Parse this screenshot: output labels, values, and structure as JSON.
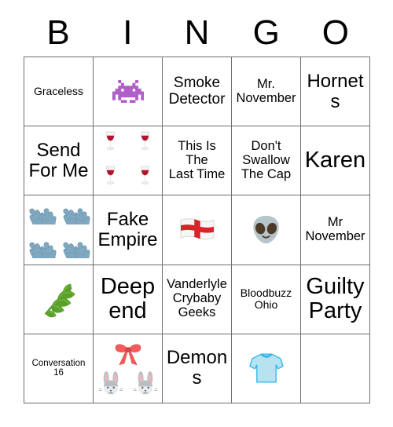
{
  "card": {
    "header_letters": [
      "B",
      "I",
      "N",
      "G",
      "O"
    ],
    "grid_size": "5x5",
    "background_color": "#ffffff",
    "border_color": "#6e6e6e",
    "text_color": "#000000"
  },
  "cells": [
    {
      "row": 1,
      "col": 1,
      "type": "text",
      "text": "Graceless",
      "size": "sm"
    },
    {
      "row": 1,
      "col": 2,
      "type": "emoji",
      "icon": "alien-monster-icon",
      "label": "space-invader",
      "count": 1
    },
    {
      "row": 1,
      "col": 3,
      "type": "text",
      "text": "Smoke\nDetector",
      "size": "lg"
    },
    {
      "row": 1,
      "col": 4,
      "type": "text",
      "text": "Mr.\nNovember",
      "size": "md"
    },
    {
      "row": 1,
      "col": 5,
      "type": "text",
      "text": "Hornets",
      "size": "xl"
    },
    {
      "row": 2,
      "col": 1,
      "type": "text",
      "text": "Send\nFor Me",
      "size": "xl"
    },
    {
      "row": 2,
      "col": 2,
      "type": "emoji",
      "icon": "wine-glass-icon",
      "label": "wine-glass",
      "count": 4
    },
    {
      "row": 2,
      "col": 3,
      "type": "text",
      "text": "This Is\nThe\nLast Time",
      "size": "md"
    },
    {
      "row": 2,
      "col": 4,
      "type": "text",
      "text": "Don't\nSwallow\nThe Cap",
      "size": "md"
    },
    {
      "row": 2,
      "col": 5,
      "type": "text",
      "text": "Karen",
      "size": "xxl"
    },
    {
      "row": 3,
      "col": 1,
      "type": "emoji",
      "icon": "gloves-icon",
      "label": "gloves",
      "count": 4
    },
    {
      "row": 3,
      "col": 2,
      "type": "text",
      "text": "Fake\nEmpire",
      "size": "xl"
    },
    {
      "row": 3,
      "col": 3,
      "type": "emoji",
      "icon": "flag-england-icon",
      "label": "england-flag",
      "count": 1
    },
    {
      "row": 3,
      "col": 4,
      "type": "emoji",
      "icon": "alien-face-icon",
      "label": "alien",
      "count": 1
    },
    {
      "row": 3,
      "col": 5,
      "type": "text",
      "text": "Mr\nNovember",
      "size": "md"
    },
    {
      "row": 4,
      "col": 1,
      "type": "emoji",
      "icon": "herb-icon",
      "label": "herb",
      "count": 1
    },
    {
      "row": 4,
      "col": 2,
      "type": "text",
      "text": "Deep\nend",
      "size": "xxl"
    },
    {
      "row": 4,
      "col": 3,
      "type": "text",
      "text": "Vanderlyle\nCrybaby\nGeeks",
      "size": "md"
    },
    {
      "row": 4,
      "col": 4,
      "type": "text",
      "text": "Bloodbuzz\nOhio",
      "size": "sm"
    },
    {
      "row": 4,
      "col": 5,
      "type": "text",
      "text": "Guilty\nParty",
      "size": "xxl"
    },
    {
      "row": 5,
      "col": 1,
      "type": "text",
      "text": "Conversation\n16",
      "size": "xs"
    },
    {
      "row": 5,
      "col": 2,
      "type": "emoji",
      "icon": "ribbon-rabbit-icon",
      "label": "ribbon-and-rabbits",
      "count": 3
    },
    {
      "row": 5,
      "col": 3,
      "type": "text",
      "text": "Demons",
      "size": "xl"
    },
    {
      "row": 5,
      "col": 4,
      "type": "emoji",
      "icon": "tshirt-icon",
      "label": "t-shirt",
      "count": 1
    }
  ],
  "colors": {
    "space_invader": "#b05fc8",
    "wine_red": "#b5132b",
    "glove_blue": "#7fa8c0",
    "flag_red": "#d8232a",
    "alien_gray": "#b6c4cc",
    "herb_green": "#66a838",
    "ribbon_red": "#f45c5c",
    "rabbit_gray": "#b9bec4",
    "tshirt_blue": "#b6e3ef"
  }
}
